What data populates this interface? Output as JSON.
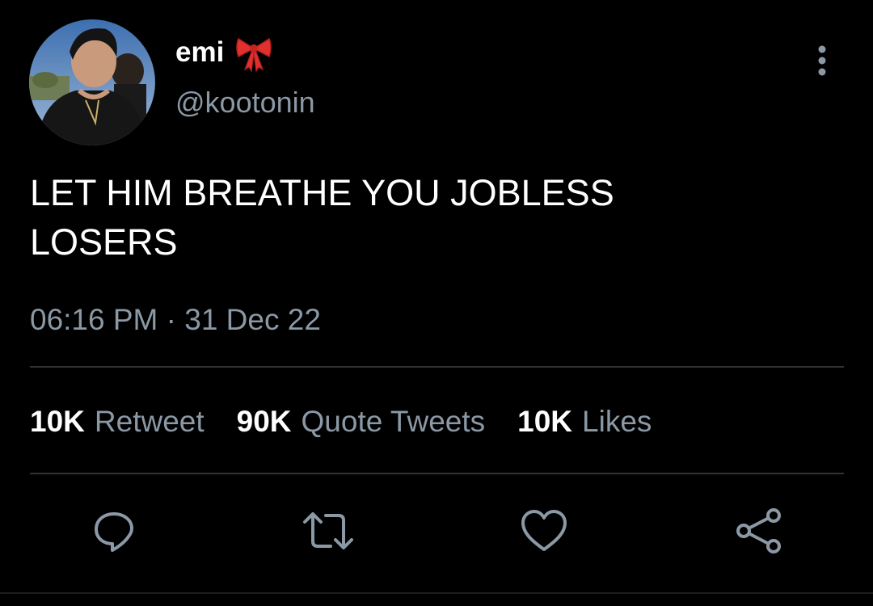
{
  "author": {
    "display_name": "emi",
    "handle": "@kootonin",
    "name_emoji_icon": "ribbon-bow-icon"
  },
  "tweet": {
    "text": "LET HIM BREATHE YOU JOBLESS\nLOSERS",
    "timestamp": "06:16 PM · 31 Dec 22"
  },
  "stats": {
    "retweets": {
      "count": "10K",
      "label": "Retweet"
    },
    "quotes": {
      "count": "90K",
      "label": "Quote Tweets"
    },
    "likes": {
      "count": "10K",
      "label": "Likes"
    }
  },
  "actions": [
    "reply-icon",
    "retweet-icon",
    "like-icon",
    "share-icon"
  ],
  "menu_icon": "more-vertical-icon",
  "colors": {
    "background": "#000000",
    "primary_text": "#ffffff",
    "secondary_text": "#8b98a5",
    "divider": "#2f3336",
    "bow": "#e0312f"
  }
}
